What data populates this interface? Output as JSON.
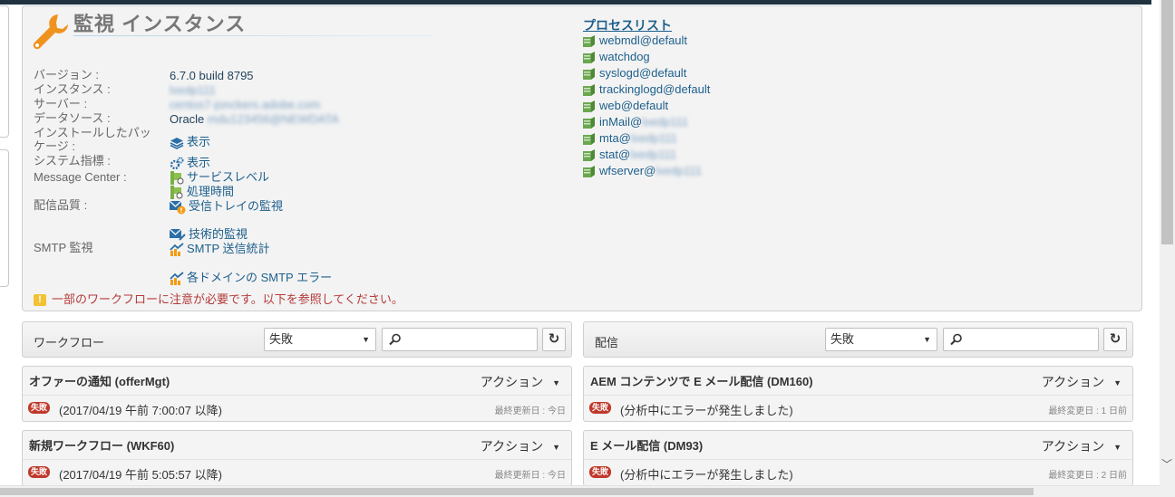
{
  "header": {
    "title": "監視 インスタンス"
  },
  "info": {
    "version_label": "バージョン :",
    "version_value": "6.7.0 build 8795",
    "instance_label": "インスタンス :",
    "instance_value": "lxedp111",
    "server_label": "サーバー :",
    "server_value": "centos7-jonckers.adobe.com",
    "datasource_label": "データソース :",
    "datasource_prefix": "Oracle",
    "datasource_value": "mdu123456@NEWDATA",
    "packages_label": "インストールしたパッケージ :",
    "packages_link": "表示",
    "sysindicators_label": "システム指標 :",
    "sysindicators_link": "表示",
    "message_center_label": "Message Center :",
    "service_level_link": "サービスレベル",
    "processing_time_link": "処理時間",
    "deliverability_label": "配信品質 :",
    "inbox_link": "受信トレイの監視",
    "technical_link": "技術的監視",
    "smtp_label": "SMTP 監視",
    "smtp_stats_link": "SMTP 送信統計",
    "smtp_errors_link": "各ドメインの SMTP エラー"
  },
  "warning": "一部のワークフローに注意が必要です。以下を参照してください。",
  "processes": {
    "title": "プロセスリスト",
    "items": [
      {
        "name": "webmdl@default",
        "suffix": ""
      },
      {
        "name": "watchdog",
        "suffix": ""
      },
      {
        "name": "syslogd@default",
        "suffix": ""
      },
      {
        "name": "trackinglogd@default",
        "suffix": ""
      },
      {
        "name": "web@default",
        "suffix": ""
      },
      {
        "name": "inMail@",
        "suffix": "lxedp111"
      },
      {
        "name": "mta@",
        "suffix": "lxedp111"
      },
      {
        "name": "stat@",
        "suffix": "lxedp111"
      },
      {
        "name": "wfserver@",
        "suffix": "lxedp111"
      }
    ]
  },
  "workflows": {
    "title": "ワークフロー",
    "filter": "失敗",
    "search_placeholder": "",
    "cards": [
      {
        "title": "オファーの通知 (offerMgt)",
        "action": "アクション",
        "badge": "失敗",
        "status": "(2017/04/19 午前 7:00:07 以降)",
        "updated": "最終更新日 : 今日"
      },
      {
        "title": "新規ワークフロー (WKF60)",
        "action": "アクション",
        "badge": "失敗",
        "status": "(2017/04/19 午前 5:05:57 以降)",
        "updated": "最終更新日 : 今日"
      }
    ]
  },
  "deliveries": {
    "title": "配信",
    "filter": "失敗",
    "search_placeholder": "",
    "cards": [
      {
        "title": "AEM コンテンツで E メール配信 (DM160)",
        "action": "アクション",
        "badge": "失敗",
        "status": "(分析中にエラーが発生しました)",
        "updated": "最終変更日 : 1 日前"
      },
      {
        "title": "E メール配信 (DM93)",
        "action": "アクション",
        "badge": "失敗",
        "status": "(分析中にエラーが発生しました)",
        "updated": "最終変更日 : 2 日前"
      }
    ]
  },
  "colors": {
    "accent": "#1d5f8c",
    "wrench": "#f0931e",
    "error": "#c0392b",
    "warning": "#b53a3a"
  }
}
